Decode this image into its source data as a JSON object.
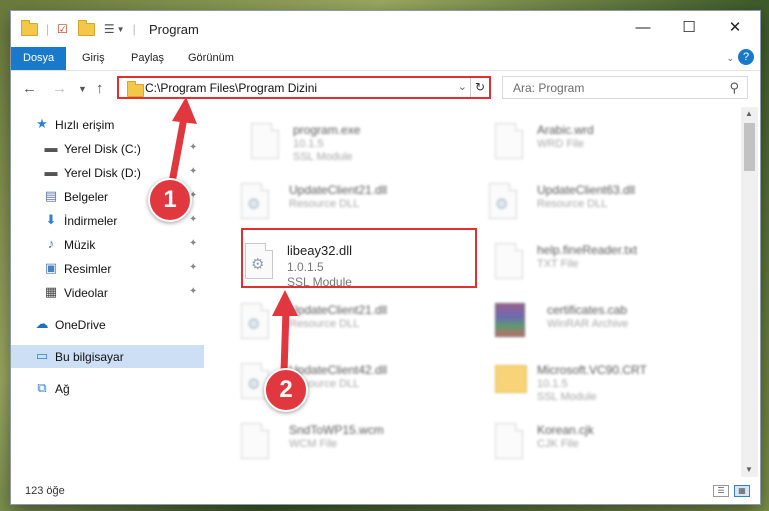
{
  "window": {
    "title": "Program"
  },
  "ribbon": {
    "tabs": [
      "Dosya",
      "Giriş",
      "Paylaş",
      "Görünüm"
    ]
  },
  "address": {
    "path": "C:\\Program Files\\Program Dizini"
  },
  "search": {
    "placeholder": "Ara: Program"
  },
  "sidebar": {
    "items": [
      {
        "label": "Hızlı erişim"
      },
      {
        "label": "Yerel Disk (C:)"
      },
      {
        "label": "Yerel Disk (D:)"
      },
      {
        "label": "Belgeler"
      },
      {
        "label": "İndirmeler"
      },
      {
        "label": "Müzik"
      },
      {
        "label": "Resimler"
      },
      {
        "label": "Videolar"
      },
      {
        "label": "OneDrive"
      },
      {
        "label": "Bu bilgisayar"
      },
      {
        "label": "Ağ"
      }
    ]
  },
  "files": [
    {
      "name": "program.exe",
      "line1": "10.1.5",
      "line2": "SSL Module"
    },
    {
      "name": "Arabic.wrd",
      "line1": "WRD File",
      "line2": ""
    },
    {
      "name": "UpdateClient21.dll",
      "line1": "Resource DLL",
      "line2": ""
    },
    {
      "name": "UpdateClient63.dll",
      "line1": "Resource DLL",
      "line2": ""
    },
    {
      "name": "libeay32.dll",
      "line1": "1.0.1.5",
      "line2": "SSL Module"
    },
    {
      "name": "help.fineReader.txt",
      "line1": "TXT File",
      "line2": ""
    },
    {
      "name": "UpdateClient21.dll",
      "line1": "Resource DLL",
      "line2": ""
    },
    {
      "name": "certificates.cab",
      "line1": "WinRAR Archive",
      "line2": ""
    },
    {
      "name": "UpdateClient42.dll",
      "line1": "Resource DLL",
      "line2": ""
    },
    {
      "name": "Microsoft.VC90.CRT",
      "line1": "10.1.5",
      "line2": "SSL Module"
    },
    {
      "name": "SndToWP15.wcm",
      "line1": "WCM File",
      "line2": ""
    },
    {
      "name": "Korean.cjk",
      "line1": "CJK File",
      "line2": ""
    }
  ],
  "status": {
    "count": "123 öğe"
  },
  "annotations": {
    "step1": "1",
    "step2": "2"
  },
  "colors": {
    "accent": "#1979ca",
    "highlight": "#e03030",
    "badge": "#e0383e"
  }
}
